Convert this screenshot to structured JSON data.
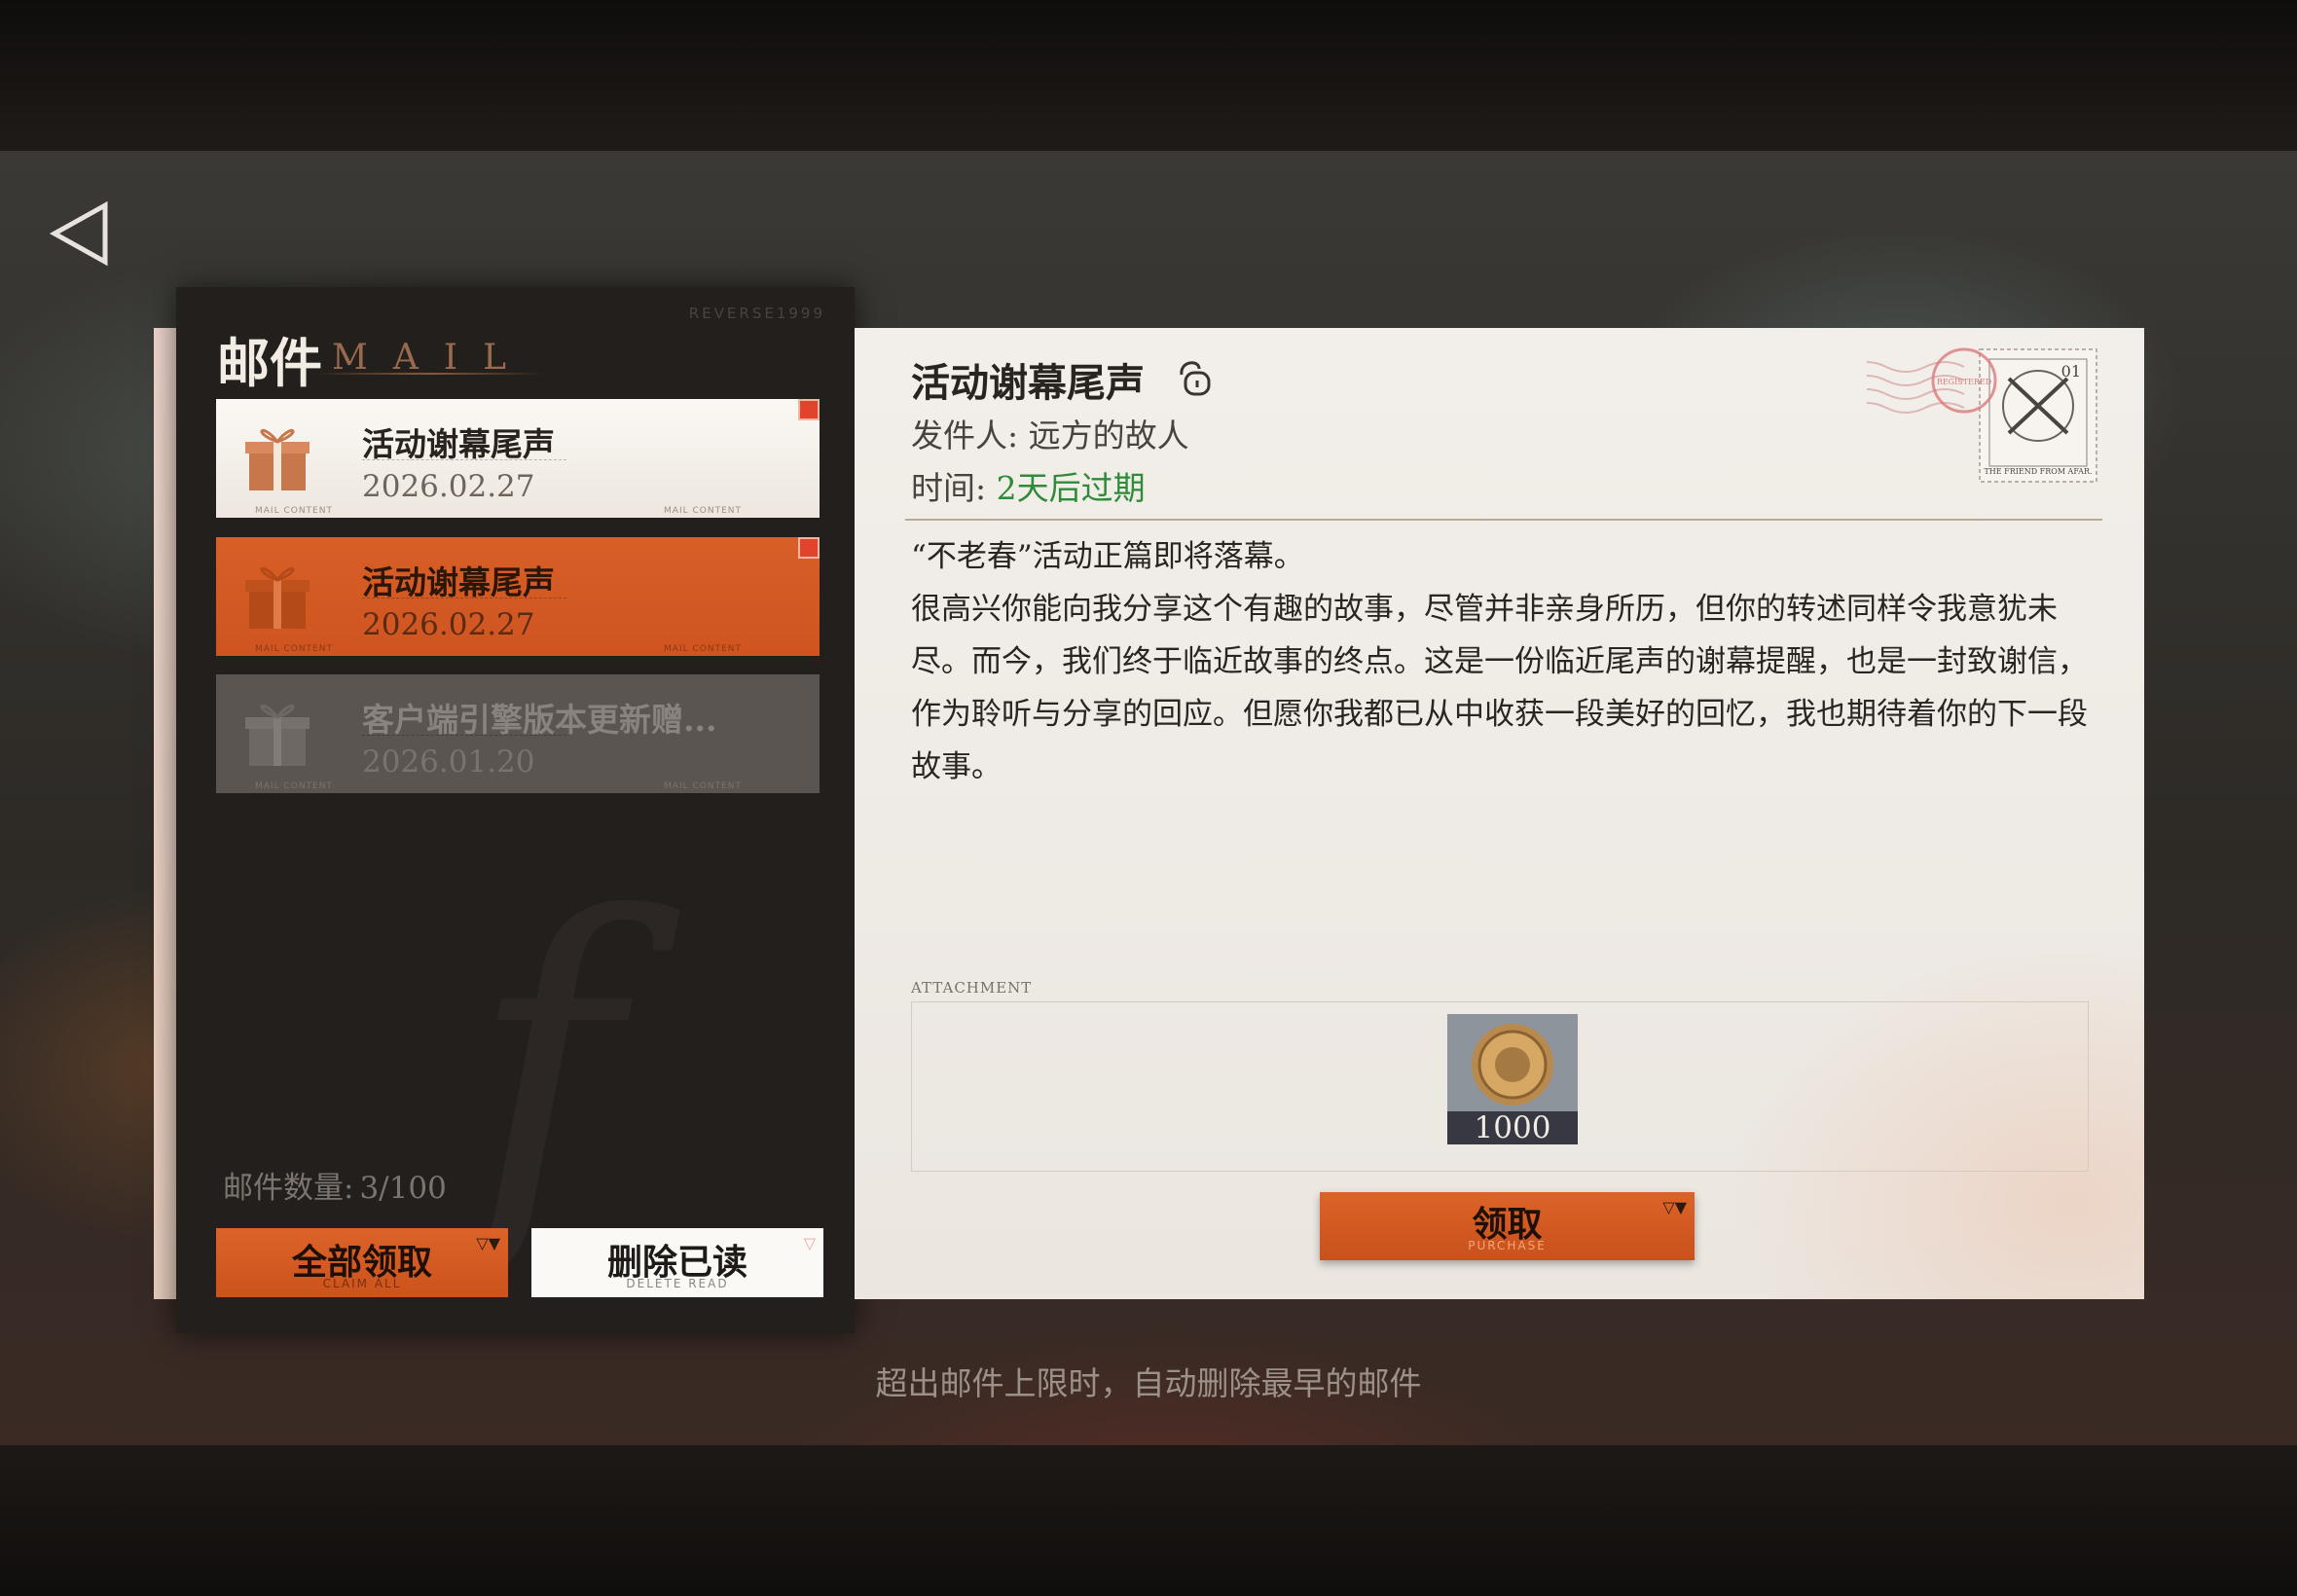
{
  "nav": {
    "back_icon": "back-triangle-icon"
  },
  "sidebar": {
    "brand": "REVERSE1999",
    "title": "邮件",
    "subtitle": "MAIL",
    "items": [
      {
        "title": "活动谢幕尾声",
        "date": "2026.02.27",
        "unread": true,
        "state": "normal",
        "tag": "MAIL CONTENT"
      },
      {
        "title": "活动谢幕尾声",
        "date": "2026.02.27",
        "unread": true,
        "state": "selected",
        "tag": "MAIL CONTENT"
      },
      {
        "title": "客户端引擎版本更新赠...",
        "date": "2026.01.20",
        "unread": false,
        "state": "read",
        "tag": "MAIL CONTENT"
      }
    ],
    "count_label": "邮件数量:",
    "count_value": "3/100",
    "claim_all": {
      "label": "全部领取",
      "sub": "CLAIM ALL"
    },
    "delete_read": {
      "label": "删除已读",
      "sub": "DELETE READ"
    }
  },
  "mail": {
    "title": "活动谢幕尾声",
    "sender_label": "发件人:",
    "sender": "远方的故人",
    "time_label": "时间:",
    "expire": "2天后过期",
    "body": [
      "“不老春”活动正篇即将落幕。",
      "很高兴你能向我分享这个有趣的故事，尽管并非亲身所历，但你的转述同样令我意犹未尽。而今，我们终于临近故事的终点。这是一份临近尾声的谢幕提醒，也是一封致谢信，作为聆听与分享的回应。但愿你我都已从中收获一段美好的回忆，我也期待着你的下一段故事。"
    ],
    "stamp": {
      "number": "01",
      "label": "THE FRIEND FROM AFAR.",
      "seal": "REGISTERED"
    },
    "attachment_label": "ATTACHMENT",
    "attachment": {
      "icon": "coin-icon",
      "quantity": "1000"
    },
    "claim": {
      "label": "领取",
      "sub": "PURCHASE"
    }
  },
  "footer_note": "超出邮件上限时，自动删除最早的邮件",
  "colors": {
    "accent": "#d85f28",
    "expire_green": "#2f8b3a",
    "unread_red": "#e2432c"
  }
}
